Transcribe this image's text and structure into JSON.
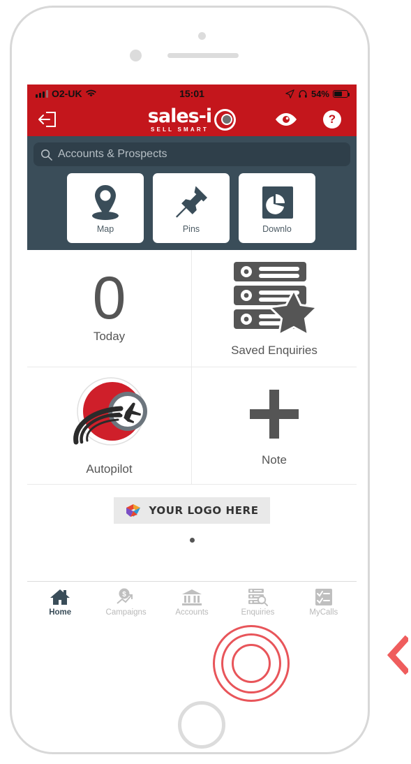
{
  "status_bar": {
    "carrier": "O2-UK",
    "time": "15:01",
    "battery_percent": "54%",
    "icons": [
      "signal-bars-icon",
      "wifi-icon",
      "location-arrow-icon",
      "headphones-icon",
      "battery-icon"
    ]
  },
  "app_bar": {
    "logout_icon": "logout-icon",
    "logo_main": "sales-i",
    "logo_sub": "SELL SMART",
    "logo_mark": "eye-logo-mark",
    "eye_icon": "eye-icon",
    "help_label": "?"
  },
  "search": {
    "placeholder": "Accounts & Prospects",
    "value": "",
    "icon": "search-icon"
  },
  "quick_tiles": [
    {
      "label": "Map",
      "icon": "map-pin-icon"
    },
    {
      "label": "Pins",
      "icon": "pushpin-icon"
    },
    {
      "label": "Downlo",
      "icon": "downloads-pie-chart-icon"
    }
  ],
  "main_grid": [
    {
      "label": "Today",
      "value": "0",
      "icon": "count-number"
    },
    {
      "label": "Saved Enquiries",
      "icon": "saved-enquiries-star-icon"
    },
    {
      "label": "Autopilot",
      "icon": "autopilot-plane-icon"
    },
    {
      "label": "Note",
      "icon": "plus-icon"
    }
  ],
  "logo_placeholder": {
    "label": "YOUR LOGO HERE",
    "icon": "ribbon-logo-icon"
  },
  "pager": {
    "dots": 1,
    "active_index": 0
  },
  "tab_bar": {
    "items": [
      {
        "label": "Home",
        "icon": "home-icon",
        "active": true
      },
      {
        "label": "Campaigns",
        "icon": "campaigns-coin-trend-icon",
        "active": false
      },
      {
        "label": "Accounts",
        "icon": "accounts-bank-icon",
        "active": false
      },
      {
        "label": "Enquiries",
        "icon": "enquiries-search-list-icon",
        "active": false
      },
      {
        "label": "MyCalls",
        "icon": "mycalls-checklist-icon",
        "active": false
      }
    ]
  },
  "annotations": {
    "tap_target": "Enquiries",
    "ripple_color": "#e8555a",
    "pointer_icon": "chevron-left-icon",
    "pointer_color": "#ef5d5d"
  },
  "colors": {
    "brand_red": "#c4161c",
    "dark_slate": "#3a4d59",
    "search_field": "#2f3f4a",
    "muted_text": "#b9b9b9",
    "body_text": "#555555"
  }
}
